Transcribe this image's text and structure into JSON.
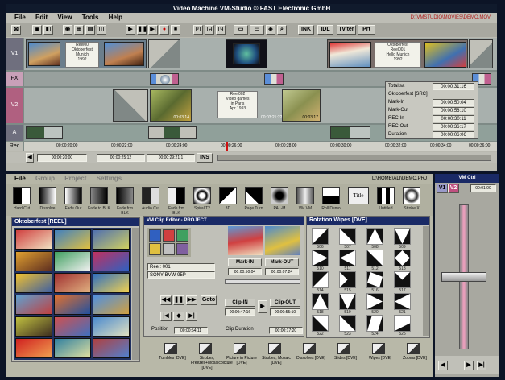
{
  "window": {
    "title": "Video Machine   VM-Studio   © FAST Electronic GmbH",
    "path": "D:\\VMSTUDIO\\MOVIES\\DEMO.MOV"
  },
  "menu": [
    "File",
    "Edit",
    "View",
    "Tools",
    "Help"
  ],
  "toolbar_buttons": [
    "INK",
    "IDL",
    "Tvlter",
    "Prt"
  ],
  "tracks": [
    "V1",
    "FX",
    "V2",
    "A",
    "Rec"
  ],
  "cards": {
    "c1": "Reel00\nOktoberfest\nMunich\n1992",
    "c2": "Reel002\nVideo games\nin Paris\nApr 1993",
    "c3": "Oktoberfest\nReel001\nHello Munich\n1992"
  },
  "clip_times": [
    "00:03:14",
    "00:03:21:22",
    "00:03:17",
    "00:03:13",
    "00:01:21:11"
  ],
  "info": [
    {
      "label": "Totalisa",
      "value": "00:00:31:16"
    },
    {
      "label": "Oktoberfest [SRC]",
      "value": ""
    },
    {
      "label": "Mark-In",
      "value": "00:00:50:04"
    },
    {
      "label": "Mark-Out",
      "value": "00:00:56:10"
    },
    {
      "label": "REC-In",
      "value": "00:00:30:11"
    },
    {
      "label": "REC-Out",
      "value": "00:00:36:17"
    },
    {
      "label": "Duration",
      "value": "00:00:06:06"
    }
  ],
  "ruler": [
    "00:00:20:00",
    "00:00:22:00",
    "00:00:24:00",
    "00:00:26:00",
    "00:00:28:00",
    "00:00:30:00",
    "00:00:32:00",
    "00:00:34:00",
    "00:00:36:00"
  ],
  "timeline_nav": {
    "pos1": "00:00:20:00",
    "pos2": "00:00:25:12",
    "pos3": "00:00:29:21:1",
    "mode": "INS"
  },
  "lower": {
    "menu": [
      "File",
      "Group",
      "Project",
      "Settings"
    ],
    "path": "L:\\HOME\\ALI\\DEMO.PRJ"
  },
  "effects": [
    "Hard Cut",
    "Dissolve",
    "Fade Out",
    "Fade to BLK",
    "Fade frm BLK",
    "Audio Cut",
    "Fade frm BLK",
    "Spiral T2",
    "3D",
    "Page Turn",
    "PAL-M",
    "VM VM",
    "Roll Demo",
    "Title",
    "Untitled",
    "Strobe X"
  ],
  "reel": {
    "title": "Oktoberfest [REEL]"
  },
  "editor": {
    "title": "VM Clip Editor - PROJECT",
    "reel_label": "Reel: 001",
    "deck": "SONY BVW-95P",
    "mark_in": "Mark-IN",
    "mark_out": "Mark-OUT",
    "mark_in_tc": "00:00:50:04",
    "mark_out_tc": "00:00:07:24",
    "clip_in": "Clip-IN",
    "clip_out": "Clip-OUT",
    "clip_in_tc": "00:00:47:16",
    "clip_out_tc": "00:00:55:10",
    "goto": "Goto",
    "position_label": "Position",
    "position": "00:00:54:11",
    "clip_duration_label": "Clip Duration",
    "clip_duration": "00:00:17:20"
  },
  "wipes": {
    "title": "Rotation Wipes [DVE]",
    "labels": [
      "506",
      "507",
      "508",
      "509",
      "510",
      "511",
      "512",
      "513",
      "514",
      "515",
      "516",
      "517",
      "518",
      "519",
      "520",
      "521",
      "522",
      "523",
      "524",
      "525"
    ]
  },
  "bottom_groups": [
    "Tumbles [DVE]",
    "Strobes, Freezes+Mosaicpicture [DVE]",
    "Picture in Picture [DVE]",
    "Strobes, Mosaic [DVE]",
    "Dissolves [DVE]",
    "Slides [DVE]",
    "Wipes [DVE]",
    "Zooms [DVE]"
  ],
  "mixer": {
    "title": "VM Ctrl",
    "v1": "V1",
    "v2": "V2",
    "tc": "00:01:00"
  },
  "colors": {
    "accent": "#1a2a66",
    "track_bg": "#a8b0ad"
  }
}
